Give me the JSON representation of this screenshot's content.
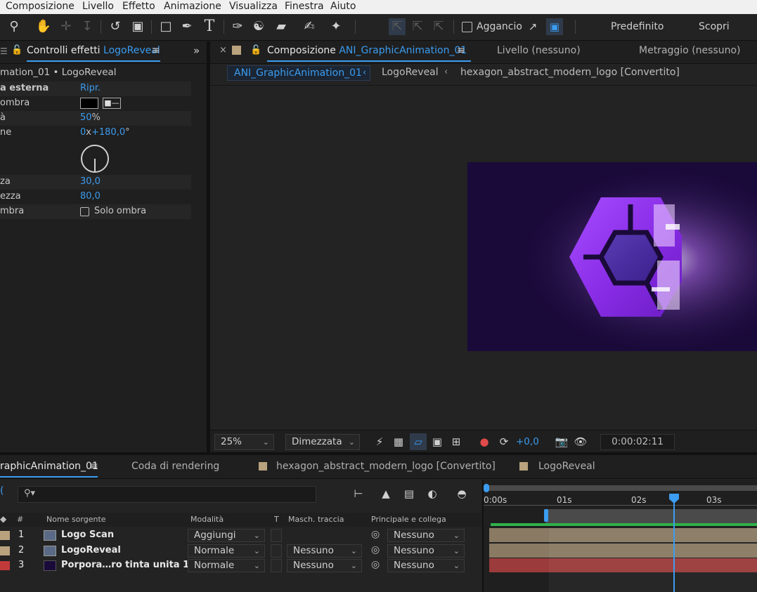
{
  "menu": [
    "Composizione",
    "Livello",
    "Effetto",
    "Animazione",
    "Visualizza",
    "Finestra",
    "Aiuto"
  ],
  "toolbar": {
    "snap_label": "Aggancio",
    "workspace_default": "Predefinito",
    "workspace_discover": "Scopri"
  },
  "effects_panel": {
    "tab_label": "Controlli effetti",
    "tab_target": "LogoReveal",
    "breadcrumb": "mation_01 • LogoReveal",
    "rows": [
      {
        "label": "a esterna",
        "value": "Ripr."
      },
      {
        "label": "ombra",
        "value": ""
      },
      {
        "label": "à",
        "value": "50",
        "unit": "%"
      },
      {
        "label": "ne",
        "value_a": "0",
        "sep": "x",
        "value_b": "+180,0",
        "unit": "°"
      },
      {
        "label": "za",
        "value": "30,0"
      },
      {
        "label": "ezza",
        "value": "80,0"
      },
      {
        "label": "mbra",
        "checkbox_label": "Solo ombra"
      }
    ]
  },
  "composition_panel": {
    "close_glyph": "×",
    "tab_prefix": "Composizione",
    "tab_name": "ANI_GraphicAnimation_01",
    "layer_tab": "Livello",
    "layer_value": "(nessuno)",
    "footage_tab": "Metraggio",
    "footage_value": "(nessuno)",
    "breadcrumbs": [
      "ANI_GraphicAnimation_01",
      "LogoReveal",
      "hexagon_abstract_modern_logo [Convertito]"
    ]
  },
  "viewer_controls": {
    "zoom": "25%",
    "resolution": "Dimezzata",
    "exposure": "+0,0",
    "timecode": "0:00:02:11"
  },
  "timeline": {
    "tabs": [
      {
        "label": "raphicAnimation_01",
        "active": true
      },
      {
        "label": "Coda di rendering"
      },
      {
        "label": "hexagon_abstract_modern_logo [Convertito]"
      },
      {
        "label": "LogoReveal"
      }
    ],
    "search_placeholder": "",
    "columns": {
      "number": "#",
      "source": "Nome sorgente",
      "mode": "Modalità",
      "t": "T",
      "matte": "Masch. traccia",
      "parent": "Principale e collega"
    },
    "layers": [
      {
        "num": "1",
        "name": "Logo Scan",
        "mode": "Aggiungi",
        "matte": "",
        "parent": "Nessuno",
        "label_color": "#b9a27e",
        "bar_color": "#8a7a63"
      },
      {
        "num": "2",
        "name": "LogoReveal",
        "mode": "Normale",
        "matte": "Nessuno",
        "parent": "Nessuno",
        "label_color": "#b9a27e",
        "bar_color": "#8a7a63"
      },
      {
        "num": "3",
        "name": "Porpora…ro tinta unita 1",
        "mode": "Normale",
        "matte": "Nessuno",
        "parent": "Nessuno",
        "label_color": "#c23a3a",
        "bar_color": "#9b3b3b"
      }
    ],
    "ruler": [
      "0:00s",
      "01s",
      "02s",
      "03s"
    ],
    "playhead_time": "0:00:02:11"
  },
  "colors": {
    "accent": "#3b9cf0",
    "comp_bg": "#1a0a3a",
    "work_area": "#2fb14a"
  }
}
